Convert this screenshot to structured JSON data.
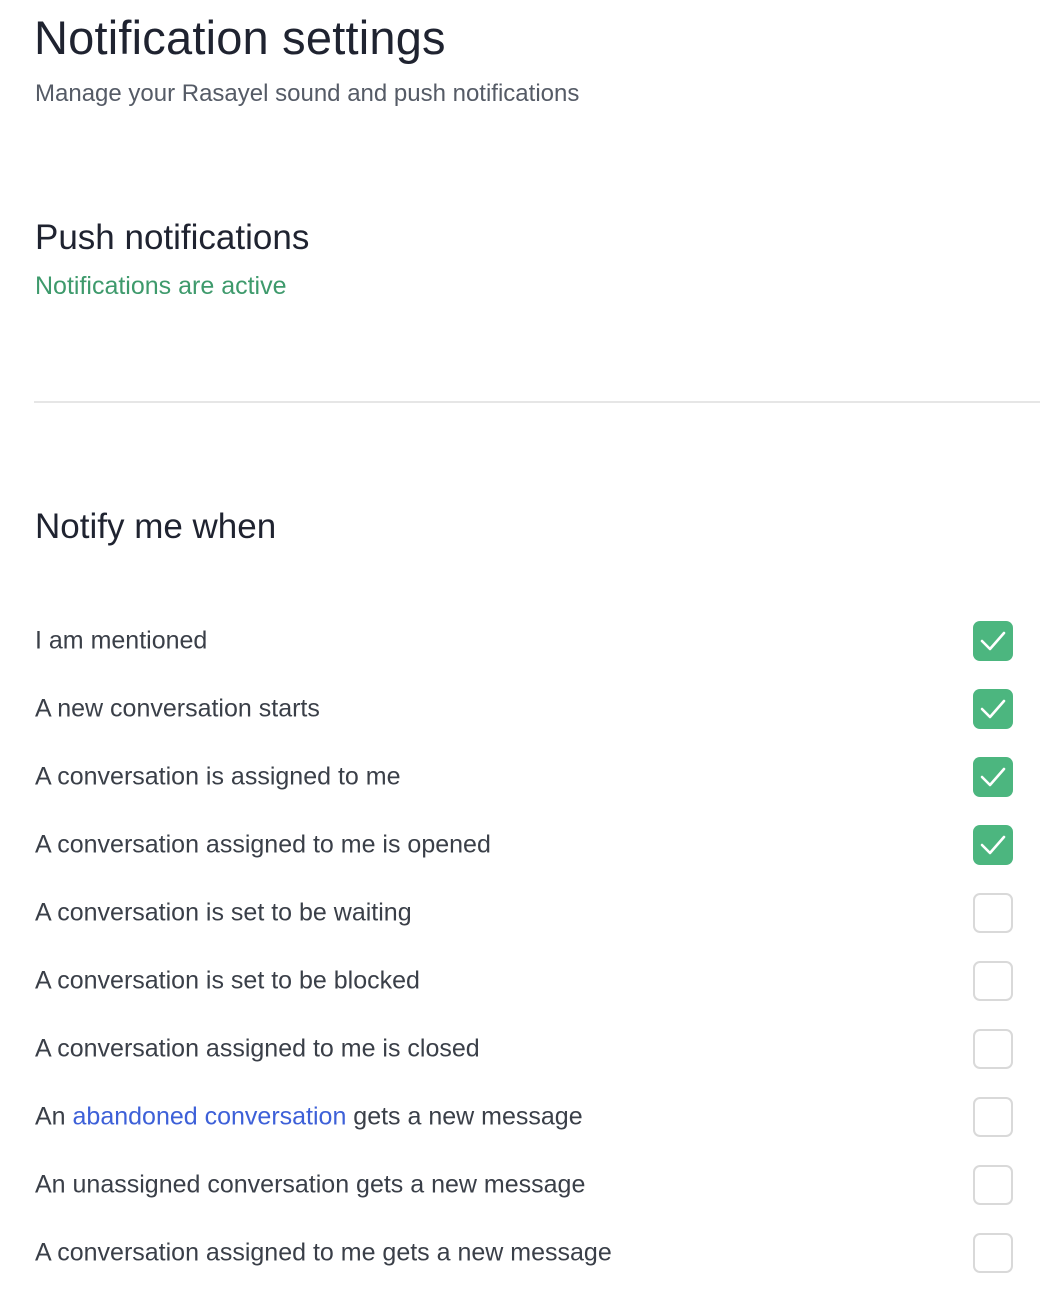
{
  "header": {
    "title": "Notification settings",
    "subtitle": "Manage your Rasayel sound and push notifications"
  },
  "push": {
    "title": "Push notifications",
    "status": "Notifications are active",
    "status_color": "#3e9a6c"
  },
  "notify": {
    "title": "Notify me when",
    "checked_color": "#4cb67f",
    "link_color": "#3d60d8",
    "options": [
      {
        "pre": "I am mentioned",
        "link": "",
        "post": "",
        "checked": true
      },
      {
        "pre": "A new conversation starts",
        "link": "",
        "post": "",
        "checked": true
      },
      {
        "pre": "A conversation is assigned to me",
        "link": "",
        "post": "",
        "checked": true
      },
      {
        "pre": "A conversation assigned to me is opened",
        "link": "",
        "post": "",
        "checked": true
      },
      {
        "pre": "A conversation is set to be waiting",
        "link": "",
        "post": "",
        "checked": false
      },
      {
        "pre": "A conversation is set to be blocked",
        "link": "",
        "post": "",
        "checked": false
      },
      {
        "pre": "A conversation assigned to me is closed",
        "link": "",
        "post": "",
        "checked": false
      },
      {
        "pre": "An ",
        "link": "abandoned conversation",
        "post": " gets a new message",
        "checked": false
      },
      {
        "pre": "An unassigned conversation gets a new message",
        "link": "",
        "post": "",
        "checked": false
      },
      {
        "pre": "A conversation assigned to me gets a new message",
        "link": "",
        "post": "",
        "checked": false
      }
    ]
  }
}
